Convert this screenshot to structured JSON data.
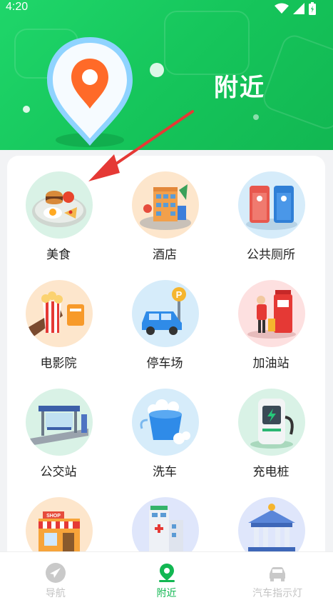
{
  "status_bar": {
    "time": "4:20"
  },
  "header": {
    "title": "附近"
  },
  "categories": [
    {
      "label": "美食",
      "icon": "food-plate-icon",
      "bg": "#d9f2e6"
    },
    {
      "label": "酒店",
      "icon": "hotel-building-icon",
      "bg": "#fde6cc"
    },
    {
      "label": "公共厕所",
      "icon": "public-toilet-icon",
      "bg": "#d6ecfa"
    },
    {
      "label": "电影院",
      "icon": "cinema-popcorn-icon",
      "bg": "#fde6cc"
    },
    {
      "label": "停车场",
      "icon": "parking-car-icon",
      "bg": "#d6ecfa"
    },
    {
      "label": "加油站",
      "icon": "gas-station-icon",
      "bg": "#fde0e0"
    },
    {
      "label": "公交站",
      "icon": "bus-stop-icon",
      "bg": "#d9f2e6"
    },
    {
      "label": "洗车",
      "icon": "car-wash-bucket-icon",
      "bg": "#d6ecfa"
    },
    {
      "label": "充电桩",
      "icon": "charging-pile-icon",
      "bg": "#d9f2e6"
    },
    {
      "label": "",
      "icon": "shop-icon",
      "bg": "#fde6cc"
    },
    {
      "label": "",
      "icon": "hospital-icon",
      "bg": "#dfe6fb"
    },
    {
      "label": "",
      "icon": "bank-icon",
      "bg": "#dfe6fb"
    }
  ],
  "tabbar": [
    {
      "label": "导航",
      "icon": "navigation-icon",
      "active": false
    },
    {
      "label": "附近",
      "icon": "location-pin-icon",
      "active": true
    },
    {
      "label": "汽车指示灯",
      "icon": "car-icon",
      "active": false
    }
  ],
  "colors": {
    "brand_green": "#12b752",
    "annotation_red": "#e53935"
  }
}
